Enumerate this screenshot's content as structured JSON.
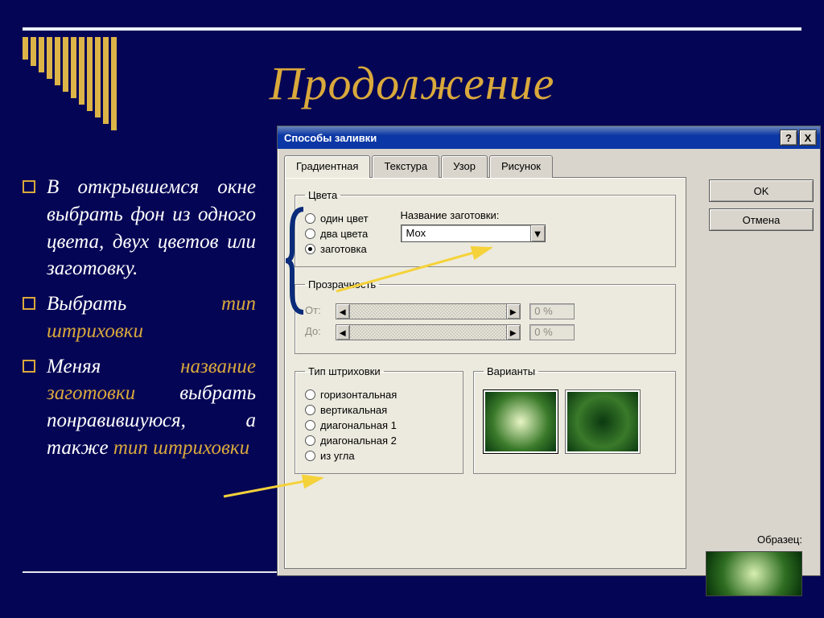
{
  "slide": {
    "title": "Продолжение",
    "bullets": [
      {
        "pre": "В открывшемся окне выбрать фон из одного цвета, двух цветов или заготовку."
      },
      {
        "pre": "Выбрать ",
        "gold1": "тип штриховки"
      },
      {
        "pre": "Меняя ",
        "gold1": "название заготовки",
        "mid": " выбрать понравившуюся, а также ",
        "gold2": "тип штриховки"
      }
    ]
  },
  "dialog": {
    "title": "Способы заливки",
    "help_btn": "?",
    "close_btn": "X",
    "tabs": [
      "Градиентная",
      "Текстура",
      "Узор",
      "Рисунок"
    ],
    "ok": "OK",
    "cancel": "Отмена",
    "colors": {
      "legend": "Цвета",
      "r1": "один цвет",
      "r2": "два цвета",
      "r3": "заготовка",
      "preset_label": "Название заготовки:",
      "preset_value": "Мох"
    },
    "transparency": {
      "legend": "Прозрачность",
      "from": "От:",
      "to": "До:",
      "val": "0 %"
    },
    "hatch": {
      "legend": "Тип штриховки",
      "r1": "горизонтальная",
      "r2": "вертикальная",
      "r3": "диагональная 1",
      "r4": "диагональная 2",
      "r5": "из угла"
    },
    "variants_legend": "Варианты",
    "sample_label": "Образец:"
  }
}
